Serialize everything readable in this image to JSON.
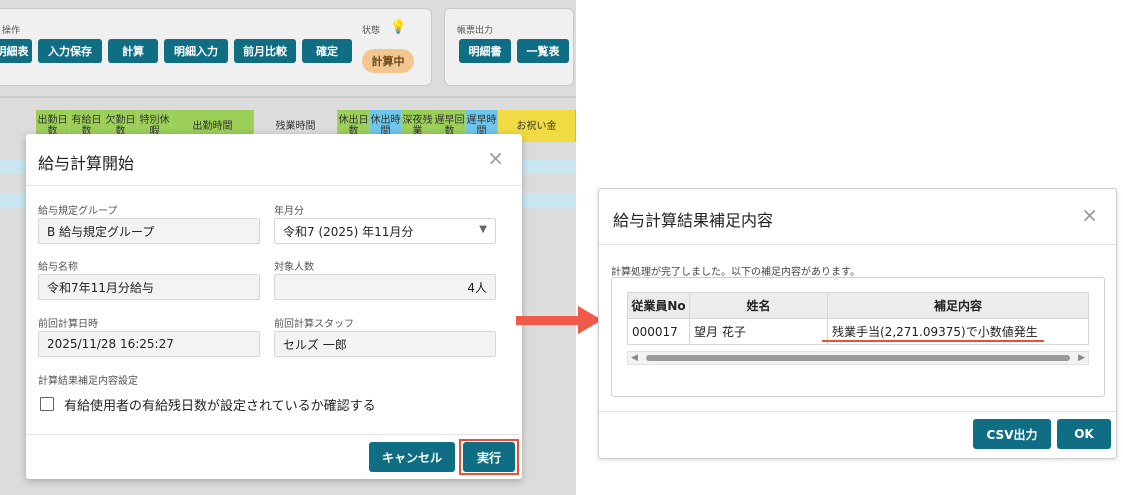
{
  "background_app": {
    "ops_group_label": "操作",
    "toolbar_buttons": [
      "明細表",
      "入力保存",
      "計算",
      "明細入力",
      "前月比較",
      "確定"
    ],
    "status_label": "状態",
    "status_value": "計算中",
    "report_group_label": "帳票出力",
    "report_buttons": [
      "明細書",
      "一覧表"
    ],
    "grid_headers": [
      "出勤日数",
      "有給日数",
      "欠勤日数",
      "特別休暇",
      "出勤時間",
      "残業時間",
      "休出日数",
      "休出時間",
      "深夜残業",
      "遅早回数",
      "遅早時間",
      "お祝い金"
    ]
  },
  "start_dialog": {
    "title": "給与計算開始",
    "close_icon": "×",
    "fields": {
      "rule_group_label": "給与規定グループ",
      "rule_group_value": "B 給与規定グループ",
      "period_label": "年月分",
      "period_value": "令和7 (2025) 年11月分",
      "pay_name_label": "給与名称",
      "pay_name_value": "令和7年11月分給与",
      "headcount_label": "対象人数",
      "headcount_value": "4人",
      "last_calc_label": "前回計算日時",
      "last_calc_value": "2025/11/28 16:25:27",
      "last_staff_label": "前回計算スタッフ",
      "last_staff_value": "セルズ 一郎"
    },
    "supplement_label": "計算結果補足内容設定",
    "checkbox_label": "有給使用者の有給残日数が設定されているか確認する",
    "checkbox_checked": false,
    "cancel_button": "キャンセル",
    "execute_button": "実行"
  },
  "result_dialog": {
    "title": "給与計算結果補足内容",
    "close_icon": "×",
    "message": "計算処理が完了しました。以下の補足内容があります。",
    "columns": [
      "従業員No",
      "姓名",
      "補足内容"
    ],
    "rows": [
      {
        "employee_no": "000017",
        "name": "望月 花子",
        "note": "残業手当(2,271.09375)で小数値発生"
      }
    ],
    "csv_button": "CSV出力",
    "ok_button": "OK"
  },
  "colors": {
    "accent": "#0f6e84",
    "highlight": "#e8503a",
    "status_pill": "#f4c68f"
  }
}
